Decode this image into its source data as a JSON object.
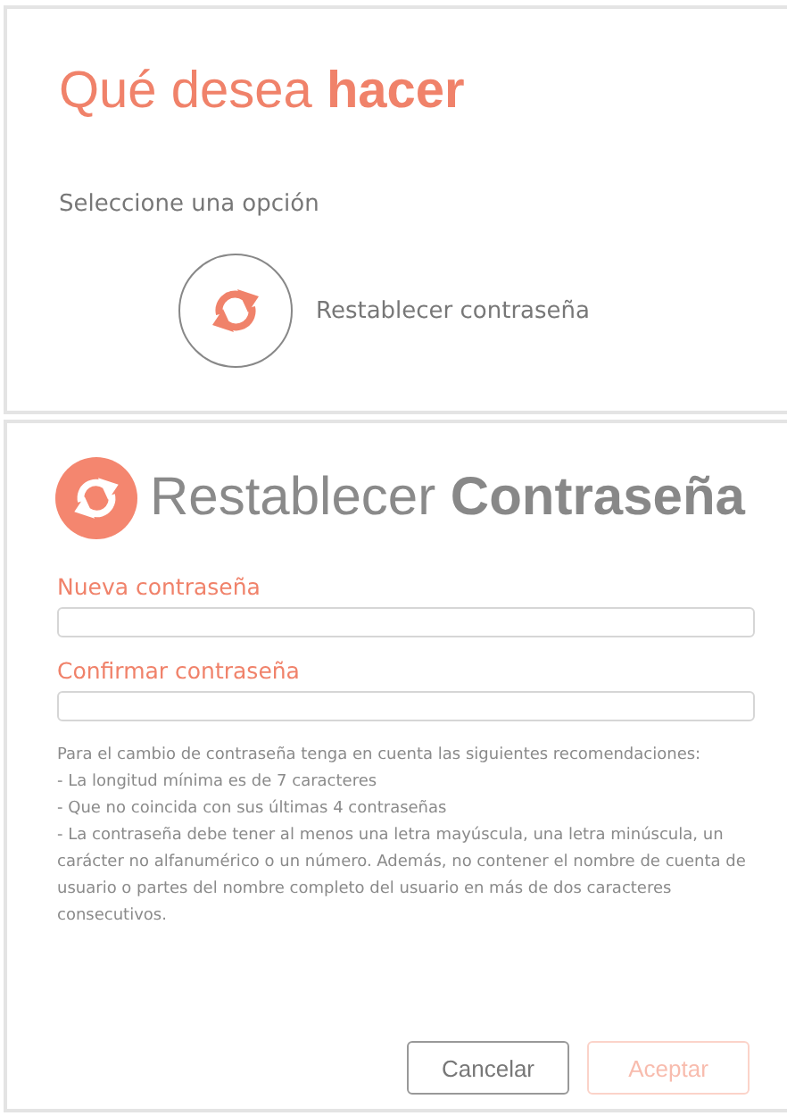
{
  "options_panel": {
    "title": "Qué desea **hacer**",
    "subtitle": "Seleccione una opción",
    "options": [
      {
        "label": "Restablecer contraseña"
      }
    ]
  },
  "reset_dialog": {
    "title": "Restablecer **Contraseña**",
    "fields": [
      {
        "label": "Nueva contraseña"
      },
      {
        "label": "Confirmar contraseña"
      }
    ],
    "recommendations": [
      "Para el cambio de contraseña tenga en cuenta las siguientes recomendaciones:",
      "- La longitud mínima es de 7 caracteres",
      "- Que no coincida con sus últimas 4 contraseñas",
      "- La contraseña debe tener al menos una letra mayúscula, una letra minúscula, un carácter no alfanumérico o un número. Además, no contener el nombre de cuenta de usuario o partes del nombre completo del usuario en más de dos caracteres consecutivos."
    ],
    "buttons": [
      {
        "label": "Cancelar",
        "kind": "secondary",
        "disabled": false
      },
      {
        "label": "Aceptar",
        "kind": "primary",
        "disabled": true
      }
    ]
  }
}
